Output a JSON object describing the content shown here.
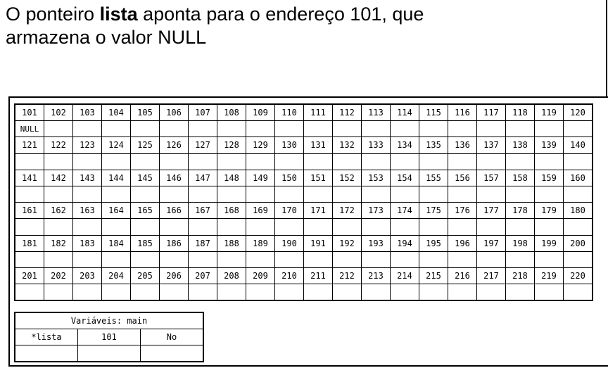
{
  "caption": {
    "part1": "O ponteiro ",
    "bold": "lista",
    "part2": " aponta para o endereço 101, que",
    "line2": "armazena o valor NULL"
  },
  "memory": {
    "rows": [
      {
        "addresses": [
          "101",
          "102",
          "103",
          "104",
          "105",
          "106",
          "107",
          "108",
          "109",
          "110",
          "111",
          "112",
          "113",
          "114",
          "115",
          "116",
          "117",
          "118",
          "119",
          "120"
        ],
        "values": [
          "NULL",
          "",
          "",
          "",
          "",
          "",
          "",
          "",
          "",
          "",
          "",
          "",
          "",
          "",
          "",
          "",
          "",
          "",
          "",
          ""
        ]
      },
      {
        "addresses": [
          "121",
          "122",
          "123",
          "124",
          "125",
          "126",
          "127",
          "128",
          "129",
          "130",
          "131",
          "132",
          "133",
          "134",
          "135",
          "136",
          "137",
          "138",
          "139",
          "140"
        ],
        "values": [
          "",
          "",
          "",
          "",
          "",
          "",
          "",
          "",
          "",
          "",
          "",
          "",
          "",
          "",
          "",
          "",
          "",
          "",
          "",
          ""
        ]
      },
      {
        "addresses": [
          "141",
          "142",
          "143",
          "144",
          "145",
          "146",
          "147",
          "148",
          "149",
          "150",
          "151",
          "152",
          "153",
          "154",
          "155",
          "156",
          "157",
          "158",
          "159",
          "160"
        ],
        "values": [
          "",
          "",
          "",
          "",
          "",
          "",
          "",
          "",
          "",
          "",
          "",
          "",
          "",
          "",
          "",
          "",
          "",
          "",
          "",
          ""
        ]
      },
      {
        "addresses": [
          "161",
          "162",
          "163",
          "164",
          "165",
          "166",
          "167",
          "168",
          "169",
          "170",
          "171",
          "172",
          "173",
          "174",
          "175",
          "176",
          "177",
          "178",
          "179",
          "180"
        ],
        "values": [
          "",
          "",
          "",
          "",
          "",
          "",
          "",
          "",
          "",
          "",
          "",
          "",
          "",
          "",
          "",
          "",
          "",
          "",
          "",
          ""
        ]
      },
      {
        "addresses": [
          "181",
          "182",
          "183",
          "184",
          "185",
          "186",
          "187",
          "188",
          "189",
          "190",
          "191",
          "192",
          "193",
          "194",
          "195",
          "196",
          "197",
          "198",
          "199",
          "200"
        ],
        "values": [
          "",
          "",
          "",
          "",
          "",
          "",
          "",
          "",
          "",
          "",
          "",
          "",
          "",
          "",
          "",
          "",
          "",
          "",
          "",
          ""
        ]
      },
      {
        "addresses": [
          "201",
          "202",
          "203",
          "204",
          "205",
          "206",
          "207",
          "208",
          "209",
          "210",
          "211",
          "212",
          "213",
          "214",
          "215",
          "216",
          "217",
          "218",
          "219",
          "220"
        ],
        "values": [
          "",
          "",
          "",
          "",
          "",
          "",
          "",
          "",
          "",
          "",
          "",
          "",
          "",
          "",
          "",
          "",
          "",
          "",
          "",
          ""
        ]
      }
    ]
  },
  "variables": {
    "title": "Variáveis: main",
    "rows": [
      [
        "*lista",
        "101",
        "No"
      ],
      [
        "",
        "",
        ""
      ]
    ]
  }
}
